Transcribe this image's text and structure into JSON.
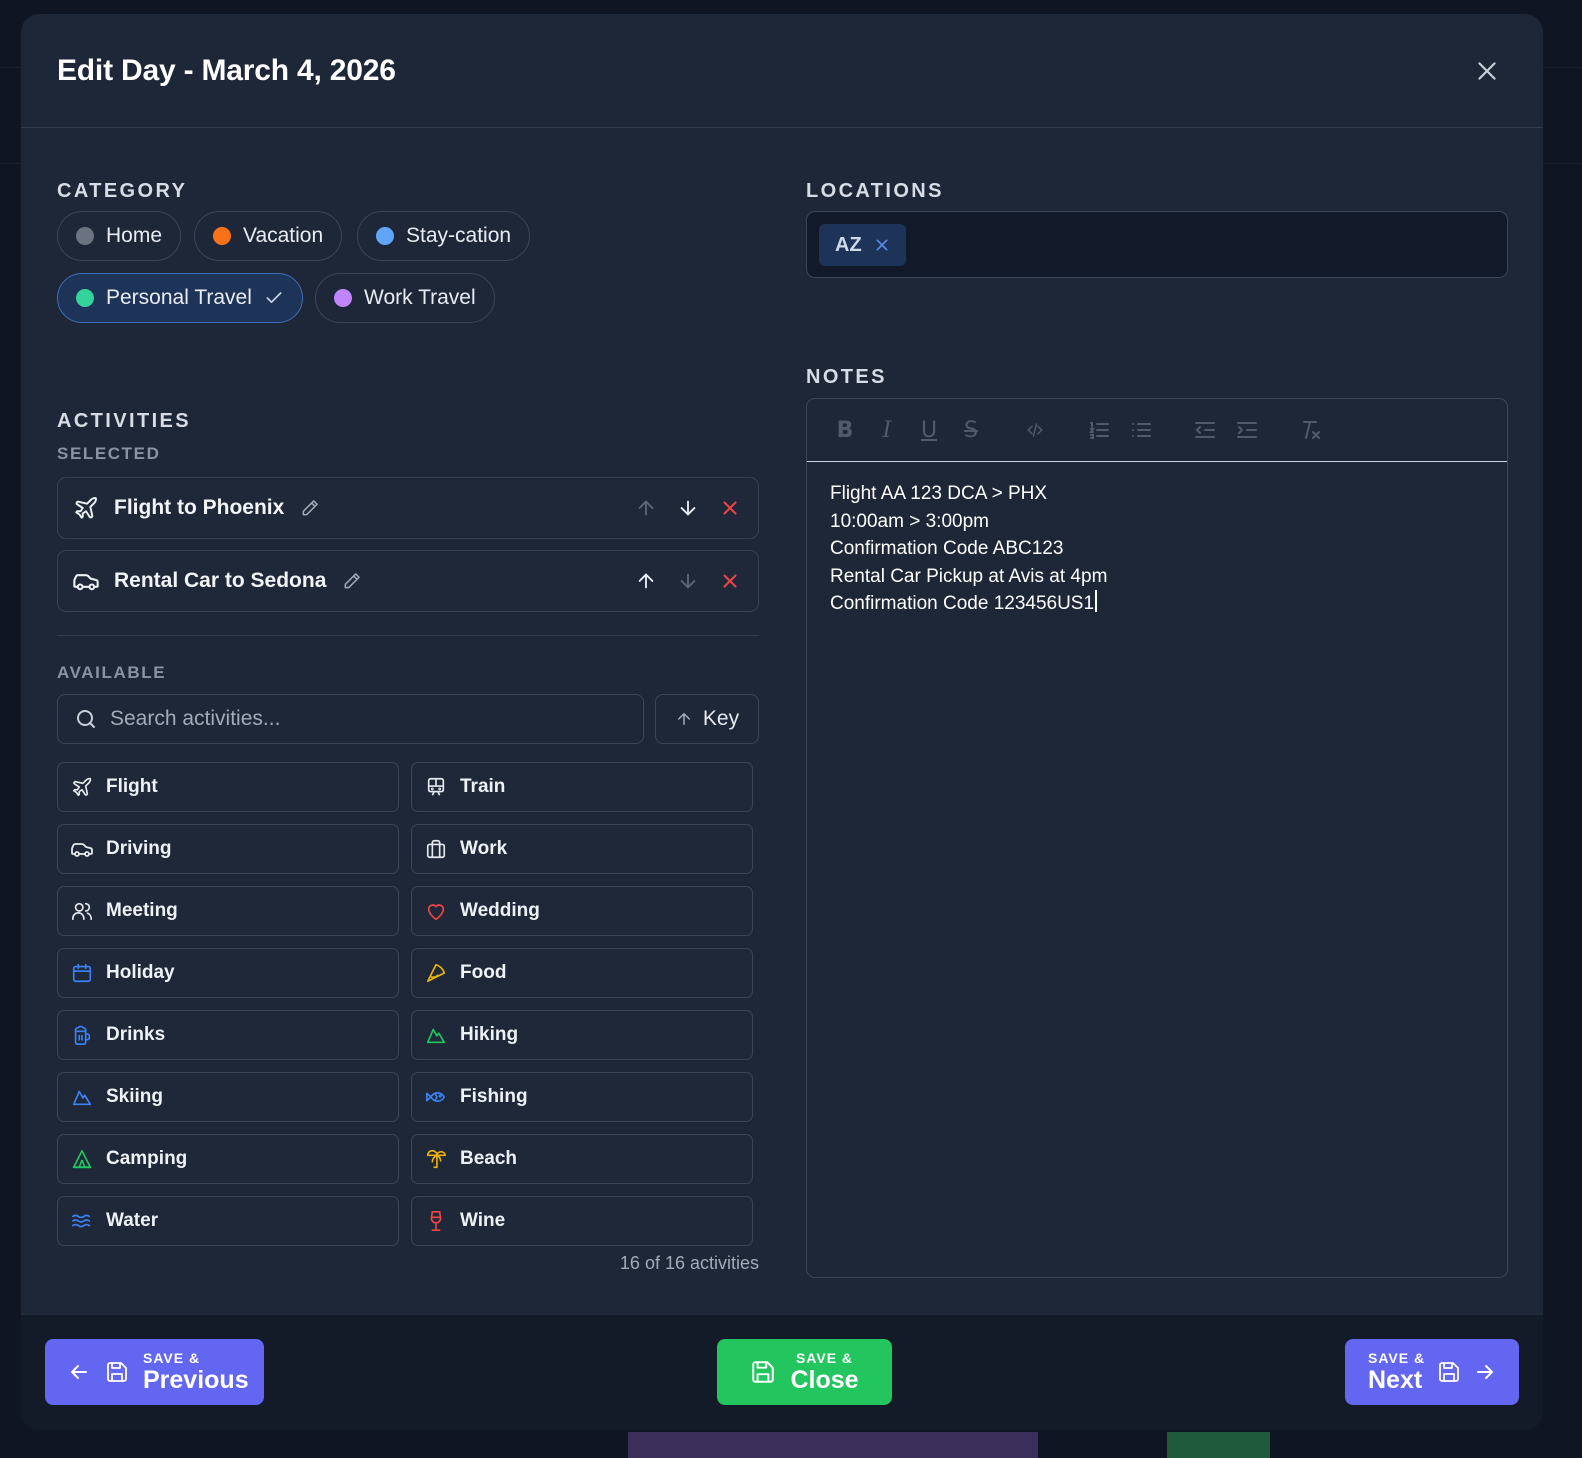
{
  "modal": {
    "title": "Edit Day - March 4, 2026"
  },
  "category": {
    "label": "CATEGORY",
    "options": [
      {
        "label": "Home",
        "color": "#6b7280",
        "selected": false
      },
      {
        "label": "Vacation",
        "color": "#f97316",
        "selected": false
      },
      {
        "label": "Stay-cation",
        "color": "#60a5fa",
        "selected": false
      },
      {
        "label": "Personal Travel",
        "color": "#34d399",
        "selected": true
      },
      {
        "label": "Work Travel",
        "color": "#c084fc",
        "selected": false
      }
    ]
  },
  "activities": {
    "label": "ACTIVITIES",
    "selected_label": "SELECTED",
    "selected": [
      {
        "label": "Flight to Phoenix",
        "icon": "plane-icon"
      },
      {
        "label": "Rental Car to Sedona",
        "icon": "car-icon"
      }
    ],
    "available_label": "AVAILABLE",
    "search_placeholder": "Search activities...",
    "key_label": "Key",
    "available": [
      {
        "label": "Flight",
        "icon": "plane-icon",
        "color": "#e6e9ef"
      },
      {
        "label": "Train",
        "icon": "train-icon",
        "color": "#e6e9ef"
      },
      {
        "label": "Driving",
        "icon": "car-icon",
        "color": "#e6e9ef"
      },
      {
        "label": "Work",
        "icon": "briefcase-icon",
        "color": "#e6e9ef"
      },
      {
        "label": "Meeting",
        "icon": "users-icon",
        "color": "#e6e9ef"
      },
      {
        "label": "Wedding",
        "icon": "heart-icon",
        "color": "#ef4444"
      },
      {
        "label": "Holiday",
        "icon": "calendar-icon",
        "color": "#3b82f6"
      },
      {
        "label": "Food",
        "icon": "pizza-icon",
        "color": "#eab308"
      },
      {
        "label": "Drinks",
        "icon": "beer-icon",
        "color": "#3b82f6"
      },
      {
        "label": "Hiking",
        "icon": "mountain-icon",
        "color": "#22c55e"
      },
      {
        "label": "Skiing",
        "icon": "mountain-snow-icon",
        "color": "#3b82f6"
      },
      {
        "label": "Fishing",
        "icon": "fish-icon",
        "color": "#3b82f6"
      },
      {
        "label": "Camping",
        "icon": "tent-icon",
        "color": "#22c55e"
      },
      {
        "label": "Beach",
        "icon": "palm-tree-icon",
        "color": "#eab308"
      },
      {
        "label": "Water",
        "icon": "waves-icon",
        "color": "#3b82f6"
      },
      {
        "label": "Wine",
        "icon": "wine-icon",
        "color": "#ef4444"
      }
    ],
    "count_text": "16 of 16 activities"
  },
  "locations": {
    "label": "LOCATIONS",
    "chips": [
      {
        "label": "AZ"
      }
    ]
  },
  "notes": {
    "label": "NOTES",
    "lines": [
      "Flight AA 123 DCA > PHX",
      "10:00am > 3:00pm",
      "Confirmation Code ABC123",
      "Rental Car Pickup at Avis at 4pm",
      "Confirmation Code 123456US1"
    ]
  },
  "footer": {
    "prev": {
      "small": "SAVE &",
      "big": "Previous"
    },
    "close": {
      "small": "SAVE &",
      "big": "Close"
    },
    "next": {
      "small": "SAVE &",
      "big": "Next"
    }
  },
  "colors": {
    "modal_bg": "#1e2738",
    "primary": "#6366f1",
    "success": "#22c55e",
    "danger": "#ef4444",
    "selected_pill_bg": "#1d3358"
  }
}
